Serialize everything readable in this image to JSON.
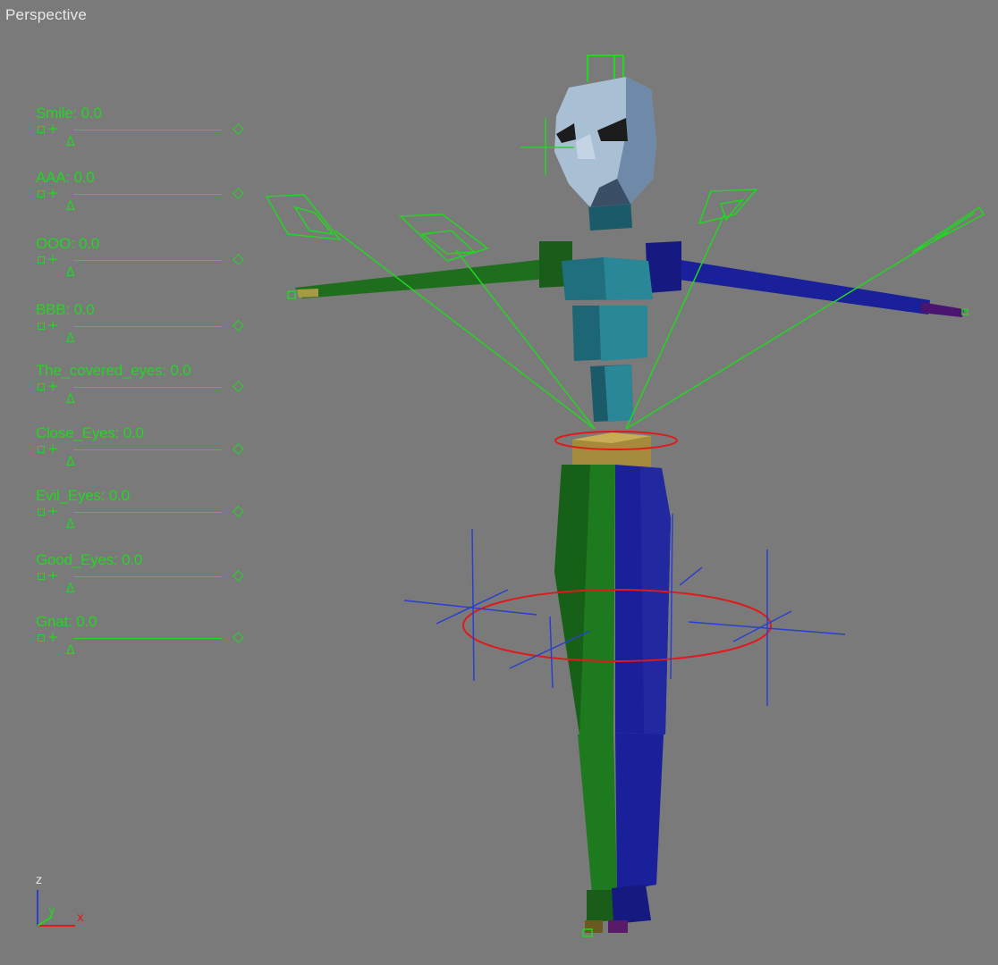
{
  "viewport": {
    "label": "Perspective",
    "background": "#7a7a7a"
  },
  "sliders": [
    {
      "label": "Smile: 0.0",
      "value": 0.0
    },
    {
      "label": "AAA: 0.0",
      "value": 0.0
    },
    {
      "label": "OOO: 0.0",
      "value": 0.0
    },
    {
      "label": "BBB: 0.0",
      "value": 0.0
    },
    {
      "label": "The_covered_eyes: 0.0",
      "value": 0.0
    },
    {
      "label": "Close_Eyes: 0.0",
      "value": 0.0
    },
    {
      "label": "Evil_Eyes: 0.0",
      "value": 0.0
    },
    {
      "label": "Good_Eyes: 0.0",
      "value": 0.0
    },
    {
      "label": "Gnat: 0.0",
      "value": 0.0
    }
  ],
  "axis_gizmo": {
    "z": "z",
    "y": "y",
    "x": "x"
  },
  "colors": {
    "helper_green": "#22d622",
    "selection_red": "#e01a1a",
    "bone_blue": "#2a3fd0",
    "head": "#9fb6cf",
    "torso": "#1f6f7f",
    "hips": "#a38a3c",
    "left_limb": "#1e7a1e",
    "right_limb": "#1a1f9a"
  }
}
